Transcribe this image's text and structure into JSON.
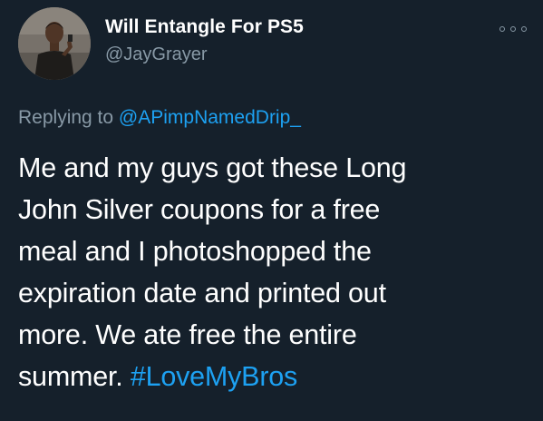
{
  "tweet": {
    "author": {
      "display_name": "Will Entangle For PS5",
      "handle": "@JayGrayer",
      "avatar": "profile-photo"
    },
    "more_icon": "more-options-icon",
    "reply_context": {
      "prefix": "Replying to ",
      "mention": "@APimpNamedDrip_"
    },
    "text_lines": [
      "Me and my guys got these Long",
      "John Silver coupons for a free",
      "meal and I photoshopped the",
      "expiration date and printed out",
      "more. We ate free the entire",
      "summer. "
    ],
    "hashtag": "#LoveMyBros"
  },
  "colors": {
    "background": "#15202b",
    "text": "#ffffff",
    "secondary_text": "#8899a6",
    "link": "#1da1f2"
  }
}
